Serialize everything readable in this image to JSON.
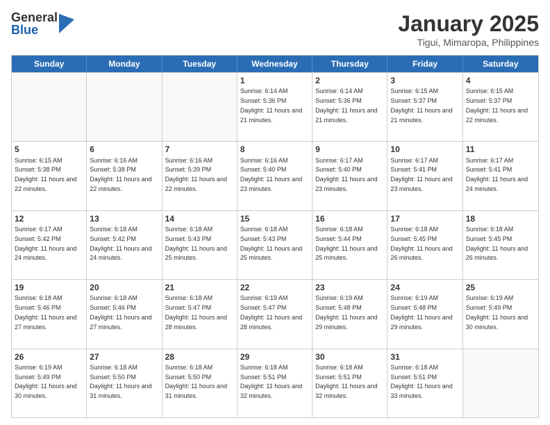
{
  "logo": {
    "general": "General",
    "blue": "Blue"
  },
  "title": "January 2025",
  "location": "Tigui, Mimaropa, Philippines",
  "days": [
    "Sunday",
    "Monday",
    "Tuesday",
    "Wednesday",
    "Thursday",
    "Friday",
    "Saturday"
  ],
  "weeks": [
    [
      {
        "day": "",
        "empty": true
      },
      {
        "day": "",
        "empty": true
      },
      {
        "day": "",
        "empty": true
      },
      {
        "day": "1",
        "sunrise": "6:14 AM",
        "sunset": "5:36 PM",
        "daylight": "11 hours and 21 minutes."
      },
      {
        "day": "2",
        "sunrise": "6:14 AM",
        "sunset": "5:36 PM",
        "daylight": "11 hours and 21 minutes."
      },
      {
        "day": "3",
        "sunrise": "6:15 AM",
        "sunset": "5:37 PM",
        "daylight": "11 hours and 21 minutes."
      },
      {
        "day": "4",
        "sunrise": "6:15 AM",
        "sunset": "5:37 PM",
        "daylight": "11 hours and 22 minutes."
      }
    ],
    [
      {
        "day": "5",
        "sunrise": "6:15 AM",
        "sunset": "5:38 PM",
        "daylight": "11 hours and 22 minutes."
      },
      {
        "day": "6",
        "sunrise": "6:16 AM",
        "sunset": "5:38 PM",
        "daylight": "11 hours and 22 minutes."
      },
      {
        "day": "7",
        "sunrise": "6:16 AM",
        "sunset": "5:39 PM",
        "daylight": "11 hours and 22 minutes."
      },
      {
        "day": "8",
        "sunrise": "6:16 AM",
        "sunset": "5:40 PM",
        "daylight": "11 hours and 23 minutes."
      },
      {
        "day": "9",
        "sunrise": "6:17 AM",
        "sunset": "5:40 PM",
        "daylight": "11 hours and 23 minutes."
      },
      {
        "day": "10",
        "sunrise": "6:17 AM",
        "sunset": "5:41 PM",
        "daylight": "11 hours and 23 minutes."
      },
      {
        "day": "11",
        "sunrise": "6:17 AM",
        "sunset": "5:41 PM",
        "daylight": "11 hours and 24 minutes."
      }
    ],
    [
      {
        "day": "12",
        "sunrise": "6:17 AM",
        "sunset": "5:42 PM",
        "daylight": "11 hours and 24 minutes."
      },
      {
        "day": "13",
        "sunrise": "6:18 AM",
        "sunset": "5:42 PM",
        "daylight": "11 hours and 24 minutes."
      },
      {
        "day": "14",
        "sunrise": "6:18 AM",
        "sunset": "5:43 PM",
        "daylight": "11 hours and 25 minutes."
      },
      {
        "day": "15",
        "sunrise": "6:18 AM",
        "sunset": "5:43 PM",
        "daylight": "11 hours and 25 minutes."
      },
      {
        "day": "16",
        "sunrise": "6:18 AM",
        "sunset": "5:44 PM",
        "daylight": "11 hours and 25 minutes."
      },
      {
        "day": "17",
        "sunrise": "6:18 AM",
        "sunset": "5:45 PM",
        "daylight": "11 hours and 26 minutes."
      },
      {
        "day": "18",
        "sunrise": "6:18 AM",
        "sunset": "5:45 PM",
        "daylight": "11 hours and 26 minutes."
      }
    ],
    [
      {
        "day": "19",
        "sunrise": "6:18 AM",
        "sunset": "5:46 PM",
        "daylight": "11 hours and 27 minutes."
      },
      {
        "day": "20",
        "sunrise": "6:18 AM",
        "sunset": "5:46 PM",
        "daylight": "11 hours and 27 minutes."
      },
      {
        "day": "21",
        "sunrise": "6:18 AM",
        "sunset": "5:47 PM",
        "daylight": "11 hours and 28 minutes."
      },
      {
        "day": "22",
        "sunrise": "6:19 AM",
        "sunset": "5:47 PM",
        "daylight": "11 hours and 28 minutes."
      },
      {
        "day": "23",
        "sunrise": "6:19 AM",
        "sunset": "5:48 PM",
        "daylight": "11 hours and 29 minutes."
      },
      {
        "day": "24",
        "sunrise": "6:19 AM",
        "sunset": "5:48 PM",
        "daylight": "11 hours and 29 minutes."
      },
      {
        "day": "25",
        "sunrise": "6:19 AM",
        "sunset": "5:49 PM",
        "daylight": "11 hours and 30 minutes."
      }
    ],
    [
      {
        "day": "26",
        "sunrise": "6:19 AM",
        "sunset": "5:49 PM",
        "daylight": "11 hours and 30 minutes."
      },
      {
        "day": "27",
        "sunrise": "6:18 AM",
        "sunset": "5:50 PM",
        "daylight": "11 hours and 31 minutes."
      },
      {
        "day": "28",
        "sunrise": "6:18 AM",
        "sunset": "5:50 PM",
        "daylight": "11 hours and 31 minutes."
      },
      {
        "day": "29",
        "sunrise": "6:18 AM",
        "sunset": "5:51 PM",
        "daylight": "11 hours and 32 minutes."
      },
      {
        "day": "30",
        "sunrise": "6:18 AM",
        "sunset": "5:51 PM",
        "daylight": "11 hours and 32 minutes."
      },
      {
        "day": "31",
        "sunrise": "6:18 AM",
        "sunset": "5:51 PM",
        "daylight": "11 hours and 33 minutes."
      },
      {
        "day": "",
        "empty": true
      }
    ]
  ]
}
